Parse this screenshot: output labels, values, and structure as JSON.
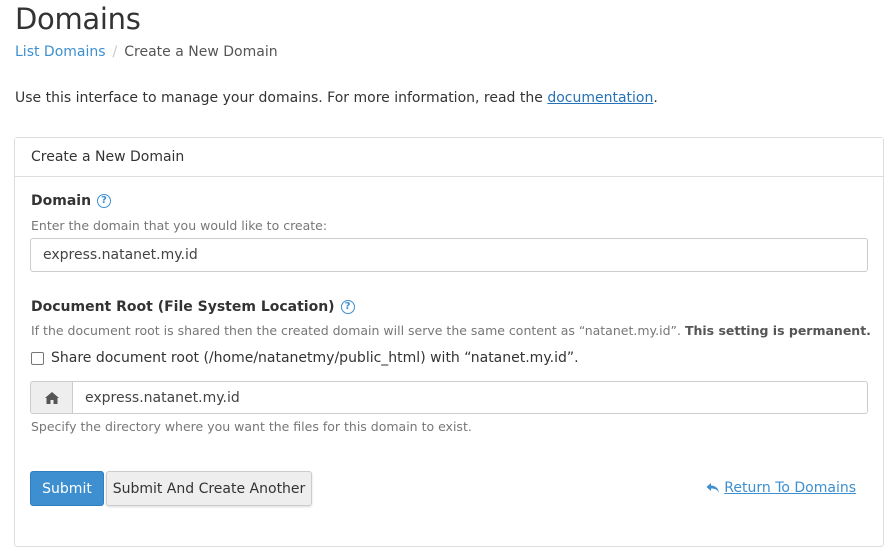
{
  "page": {
    "title": "Domains",
    "breadcrumb": {
      "link": "List Domains",
      "separator": "/",
      "current": "Create a New Domain"
    },
    "intro": {
      "text": "Use this interface to manage your domains. For more information, read the ",
      "link": "documentation",
      "suffix": "."
    }
  },
  "panel": {
    "heading": "Create a New Domain",
    "domain": {
      "label": "Domain",
      "help_icon": "question-circle-icon",
      "hint": "Enter the domain that you would like to create:",
      "value": "express.natanet.my.id"
    },
    "document_root": {
      "label": "Document Root (File System Location)",
      "help_icon": "question-circle-icon",
      "hint_text": "If the document root is shared then the created domain will serve the same content as “natanet.my.id”. ",
      "hint_bold": "This setting is permanent.",
      "share_checkbox_label": "Share document root (/home/natanetmy/public_html) with “natanet.my.id”.",
      "share_checked": false,
      "addon_icon": "home-icon",
      "value": "express.natanet.my.id",
      "footer_hint": "Specify the directory where you want the files for this domain to exist."
    },
    "buttons": {
      "submit": "Submit",
      "submit_another": "Submit And Create Another",
      "return": "Return To Domains",
      "return_icon": "reply-arrow-icon"
    }
  },
  "colors": {
    "accent": "#3d8fcf",
    "link": "#2672b8",
    "border": "#dddddd"
  }
}
